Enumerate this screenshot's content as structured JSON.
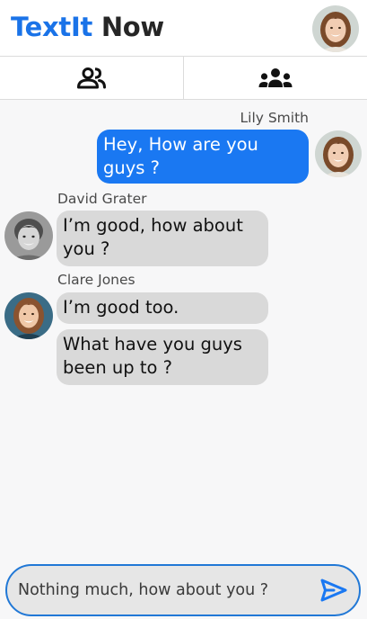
{
  "app": {
    "brand": "TextIt",
    "brand_suffix": " Now",
    "brand_color": "#1a73e8"
  },
  "header": {
    "profile_avatar_icon": "user-avatar"
  },
  "tabs": [
    {
      "icon": "friends-icon"
    },
    {
      "icon": "groups-icon"
    }
  ],
  "messages": [
    {
      "sender": "Lily Smith",
      "direction": "outgoing",
      "texts": [
        "Hey, How are you guys ?"
      ]
    },
    {
      "sender": "David Grater",
      "direction": "incoming",
      "texts": [
        "I’m good, how about you ?"
      ]
    },
    {
      "sender": "Clare Jones",
      "direction": "incoming",
      "texts": [
        "I’m good too.",
        "What have you guys been up to ?"
      ]
    }
  ],
  "composer": {
    "value": "",
    "placeholder": "Nothing much, how about you ?",
    "send_icon": "send-icon"
  },
  "colors": {
    "accent": "#1a78f2",
    "incoming_bubble": "#d9d9d9",
    "composer_border": "#2178d6"
  }
}
